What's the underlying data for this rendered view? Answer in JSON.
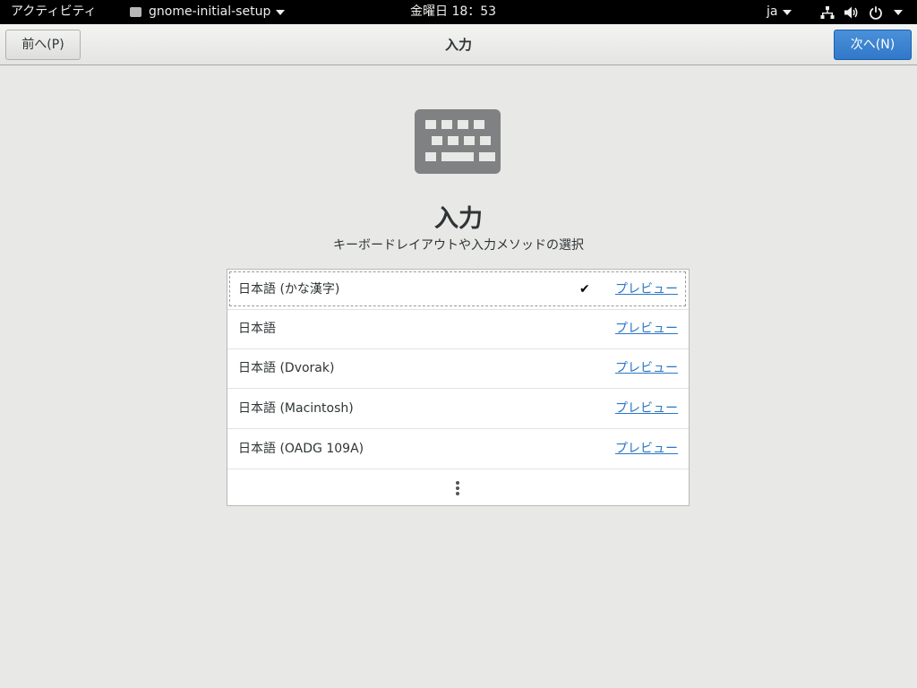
{
  "topbar": {
    "activities": "アクティビティ",
    "app_name": "gnome-initial-setup",
    "clock": "金曜日 18：53",
    "lang": "ja"
  },
  "header": {
    "prev_label": "前へ(P)",
    "title": "入力",
    "next_label": "次へ(N)"
  },
  "main": {
    "heading": "入力",
    "subtitle": "キーボードレイアウトや入力メソッドの選択",
    "preview_label": "プレビュー",
    "layouts": [
      {
        "name": "日本語 (かな漢字)",
        "selected": true
      },
      {
        "name": "日本語",
        "selected": false
      },
      {
        "name": "日本語 (Dvorak)",
        "selected": false
      },
      {
        "name": "日本語 (Macintosh)",
        "selected": false
      },
      {
        "name": "日本語 (OADG 109A)",
        "selected": false
      }
    ]
  },
  "colors": {
    "accent": "#3178c9",
    "link": "#2a76c6",
    "background": "#e8e8e7",
    "panel": "#000000"
  }
}
